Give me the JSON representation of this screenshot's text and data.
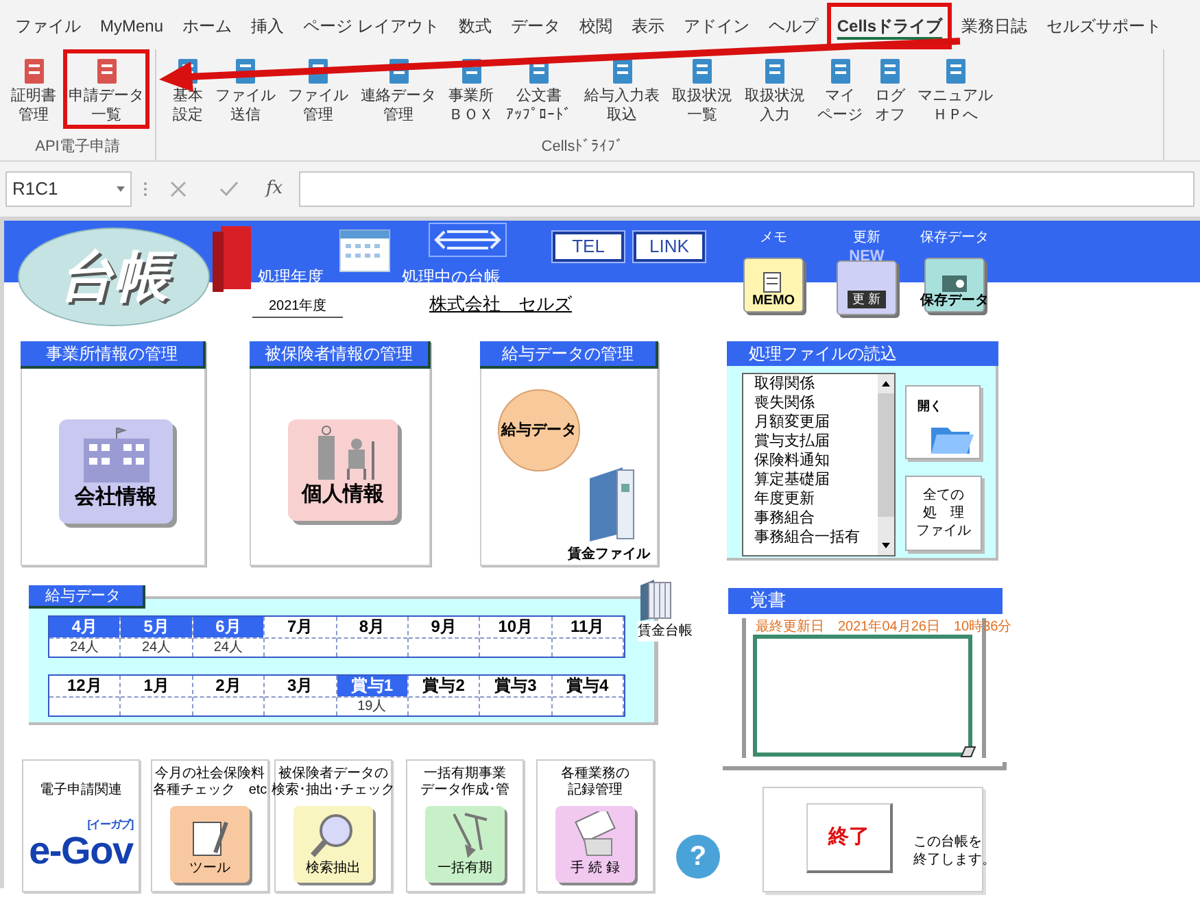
{
  "menu_tabs": [
    {
      "label": "ファイル",
      "selected": false,
      "highlighted": false
    },
    {
      "label": "MyMenu",
      "selected": false,
      "highlighted": false
    },
    {
      "label": "ホーム",
      "selected": false,
      "highlighted": false
    },
    {
      "label": "挿入",
      "selected": false,
      "highlighted": false
    },
    {
      "label": "ページ レイアウト",
      "selected": false,
      "highlighted": false
    },
    {
      "label": "数式",
      "selected": false,
      "highlighted": false
    },
    {
      "label": "データ",
      "selected": false,
      "highlighted": false
    },
    {
      "label": "校閲",
      "selected": false,
      "highlighted": false
    },
    {
      "label": "表示",
      "selected": false,
      "highlighted": false
    },
    {
      "label": "アドイン",
      "selected": false,
      "highlighted": false
    },
    {
      "label": "ヘルプ",
      "selected": false,
      "highlighted": false
    },
    {
      "label": "Cellsドライブ",
      "selected": true,
      "highlighted": true
    },
    {
      "label": "業務日誌",
      "selected": false,
      "highlighted": false
    },
    {
      "label": "セルズサポート",
      "selected": false,
      "highlighted": false
    }
  ],
  "ribbon_groups": [
    {
      "label": "API電子申請",
      "buttons": [
        {
          "lines": [
            "証明書",
            "管理"
          ],
          "highlighted": false
        },
        {
          "lines": [
            "申請データ",
            "一覧"
          ],
          "highlighted": true
        }
      ]
    },
    {
      "label": "Cellsﾄﾞﾗｲﾌﾞ",
      "buttons": [
        {
          "lines": [
            "基本",
            "設定"
          ],
          "highlighted": false
        },
        {
          "lines": [
            "ファイル",
            "送信"
          ],
          "highlighted": false
        },
        {
          "lines": [
            "ファイル",
            "管理"
          ],
          "highlighted": false
        },
        {
          "lines": [
            "連絡データ",
            "管理"
          ],
          "highlighted": false
        },
        {
          "lines": [
            "事業所",
            "ＢＯＸ"
          ],
          "highlighted": false
        },
        {
          "lines": [
            "公文書",
            "ｱｯﾌﾟﾛｰﾄﾞ"
          ],
          "highlighted": false
        },
        {
          "lines": [
            "給与入力表",
            "取込"
          ],
          "highlighted": false
        },
        {
          "lines": [
            "取扱状況",
            "一覧"
          ],
          "highlighted": false
        },
        {
          "lines": [
            "取扱状況",
            "入力"
          ],
          "highlighted": false
        },
        {
          "lines": [
            "マイ",
            "ページ"
          ],
          "highlighted": false
        },
        {
          "lines": [
            "ログ",
            "オフ"
          ],
          "highlighted": false
        },
        {
          "lines": [
            "マニュアル",
            "ＨＰへ"
          ],
          "highlighted": false
        }
      ]
    }
  ],
  "formula_bar": {
    "name_box": "R1C1",
    "function_label": "fx"
  },
  "header": {
    "logo": "台帳",
    "year_label": "処理年度",
    "ledger_label": "処理中の台帳",
    "links": [
      "TEL",
      "LINK"
    ],
    "tools": [
      {
        "kind": "memo",
        "label": "メモ",
        "badge": "MEMO"
      },
      {
        "kind": "update",
        "label": "更新",
        "badge": "更 新",
        "flag": "NEW"
      },
      {
        "kind": "save",
        "label": "保存データ",
        "badge": "保存データ"
      }
    ]
  },
  "year": "2021年度",
  "company": "株式会社　セルズ",
  "panels": [
    {
      "kind": "company",
      "title": "事業所情報の管理",
      "button": "会社情報"
    },
    {
      "kind": "person",
      "title": "被保険者情報の管理",
      "button": "個人情報"
    },
    {
      "kind": "salary",
      "title": "給与データの管理",
      "button": "給与データ",
      "extra": "賃金ファイル"
    }
  ],
  "file_panel": {
    "title": "処理ファイルの読込",
    "items": [
      "取得関係",
      "喪失関係",
      "月額変更届",
      "賞与支払届",
      "保険料通知",
      "算定基礎届",
      "年度更新",
      "事務組合",
      "事務組合一括有"
    ],
    "open_button": "開く",
    "all_button": [
      "全ての",
      "処　理",
      "ファイル"
    ]
  },
  "salary_panel": {
    "title": "給与データ",
    "ledger_label": "賃金台帳",
    "rows": [
      [
        {
          "label": "4月",
          "count": "24人",
          "selected": true
        },
        {
          "label": "5月",
          "count": "24人",
          "selected": true
        },
        {
          "label": "6月",
          "count": "24人",
          "selected": true
        },
        {
          "label": "7月",
          "selected": false
        },
        {
          "label": "8月",
          "selected": false
        },
        {
          "label": "9月",
          "selected": false
        },
        {
          "label": "10月",
          "selected": false
        },
        {
          "label": "11月",
          "selected": false
        }
      ],
      [
        {
          "label": "12月",
          "selected": false
        },
        {
          "label": "1月",
          "selected": false
        },
        {
          "label": "2月",
          "selected": false
        },
        {
          "label": "3月",
          "selected": false
        },
        {
          "label": "賞与1",
          "count": "19人",
          "selected": true
        },
        {
          "label": "賞与2",
          "selected": false
        },
        {
          "label": "賞与3",
          "selected": false
        },
        {
          "label": "賞与4",
          "selected": false
        }
      ]
    ]
  },
  "memo_panel": {
    "title": "覚書",
    "updated_label": "最終更新日",
    "updated_value": "2021年04月26日　10時36分"
  },
  "shortcuts": [
    {
      "kind": "egov",
      "caption": [
        "電子申請関連"
      ],
      "button": "e-Gov",
      "sub": "[イーガブ]"
    },
    {
      "kind": "tool",
      "caption": [
        "今月の社会保険料",
        "各種チェック　etc"
      ],
      "button": "ツール"
    },
    {
      "kind": "search",
      "caption": [
        "被保険者データの",
        "検索･抽出･チェック"
      ],
      "button": "検索抽出"
    },
    {
      "kind": "bulk",
      "caption": [
        "一括有期事業",
        "データ作成･管"
      ],
      "button": "一括有期"
    },
    {
      "kind": "record",
      "caption": [
        "各種業務の",
        "記録管理"
      ],
      "button": "手 続 録"
    }
  ],
  "help": "?",
  "exit": {
    "button": "終了",
    "note": [
      "この台帳を",
      "終了します。"
    ]
  }
}
